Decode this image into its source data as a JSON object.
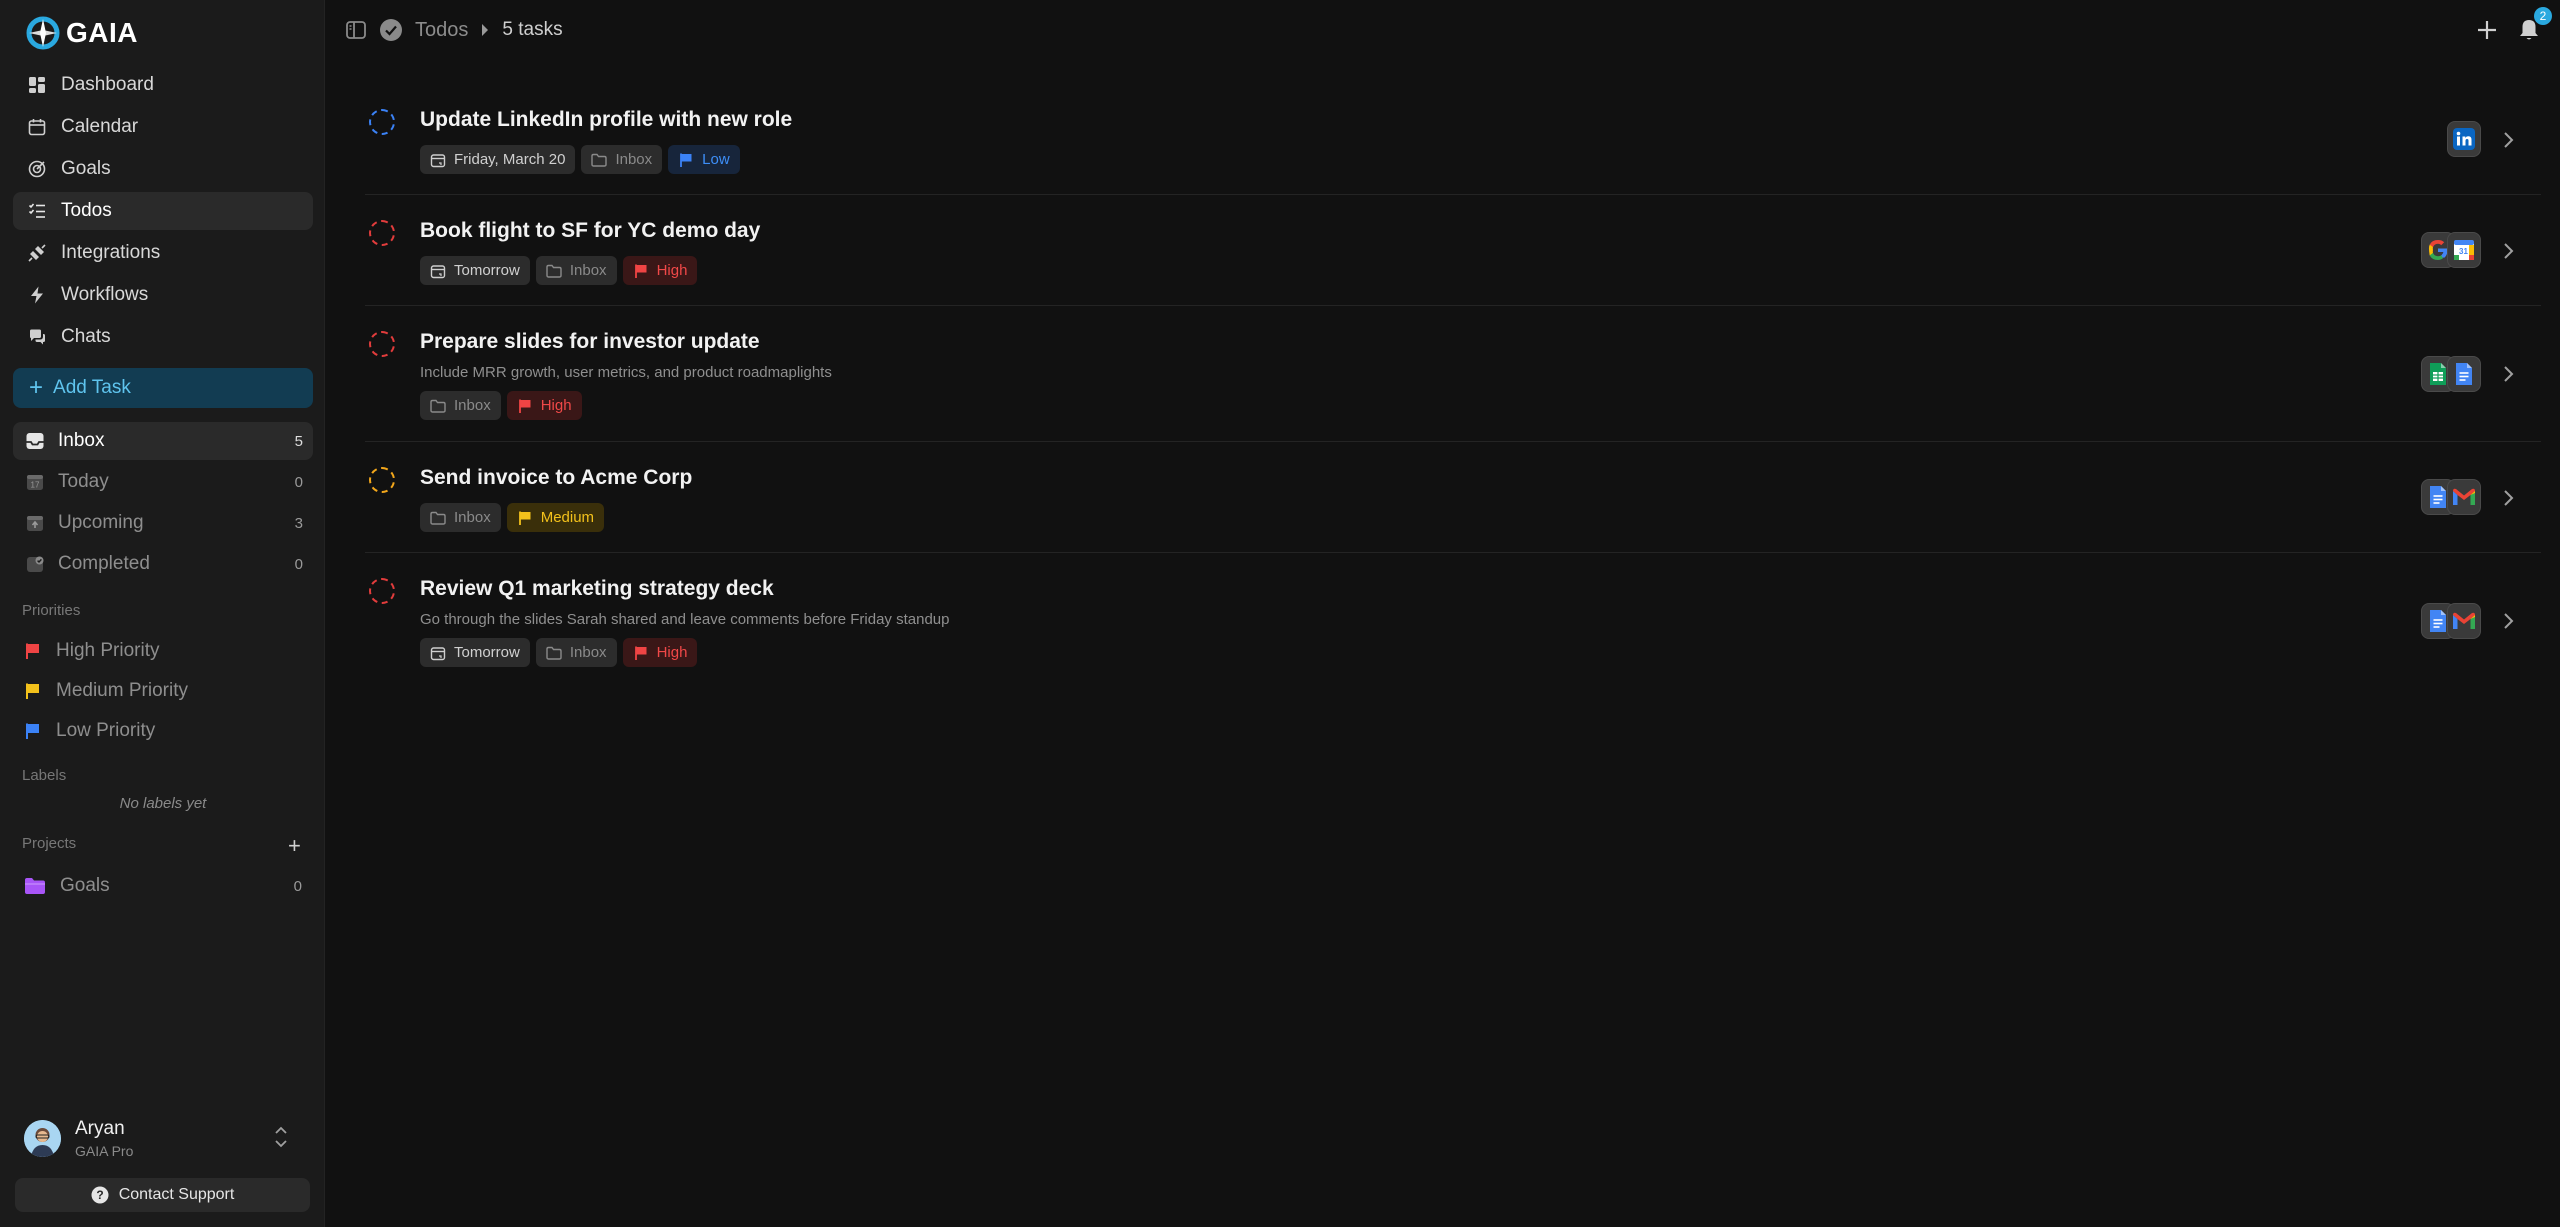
{
  "app": {
    "logo_text": "GAIA"
  },
  "sidebar": {
    "nav": [
      {
        "label": "Dashboard",
        "icon": "dashboard-icon"
      },
      {
        "label": "Calendar",
        "icon": "calendar-icon"
      },
      {
        "label": "Goals",
        "icon": "goals-icon"
      },
      {
        "label": "Todos",
        "icon": "todos-icon",
        "active": true
      },
      {
        "label": "Integrations",
        "icon": "integrations-icon"
      },
      {
        "label": "Workflows",
        "icon": "lightning-icon"
      },
      {
        "label": "Chats",
        "icon": "chats-icon"
      }
    ],
    "add_task_label": "Add Task",
    "filters": [
      {
        "label": "Inbox",
        "count": "5",
        "active": true
      },
      {
        "label": "Today",
        "count": "0"
      },
      {
        "label": "Upcoming",
        "count": "3"
      },
      {
        "label": "Completed",
        "count": "0"
      }
    ],
    "priorities_heading": "Priorities",
    "priorities": [
      {
        "label": "High Priority",
        "color": "#ef4444"
      },
      {
        "label": "Medium Priority",
        "color": "#f3c11b"
      },
      {
        "label": "Low Priority",
        "color": "#3b82f6"
      }
    ],
    "labels_heading": "Labels",
    "labels_empty": "No labels yet",
    "projects_heading": "Projects",
    "projects": [
      {
        "label": "Goals",
        "count": "0",
        "color": "#a855f7"
      }
    ],
    "user": {
      "name": "Aryan",
      "plan": "GAIA Pro"
    },
    "support_label": "Contact Support"
  },
  "topbar": {
    "title": "Todos",
    "task_count": "5 tasks",
    "notification_count": "2"
  },
  "colors": {
    "accent": "#2aa9e0",
    "high": "#ef4444",
    "medium": "#f3c11b",
    "low": "#3b82f6"
  },
  "tasks": [
    {
      "title": "Update LinkedIn profile with new role",
      "description": "",
      "date": "Friday, March 20",
      "project": "Inbox",
      "priority": "Low",
      "apps": [
        "linkedin-icon"
      ]
    },
    {
      "title": "Book flight to SF for YC demo day",
      "description": "",
      "date": "Tomorrow",
      "project": "Inbox",
      "priority": "High",
      "apps": [
        "google-icon",
        "google-calendar-icon"
      ]
    },
    {
      "title": "Prepare slides for investor update",
      "description": "Include MRR growth, user metrics, and product roadmaplights",
      "date": "",
      "project": "Inbox",
      "priority": "High",
      "apps": [
        "google-sheets-icon",
        "google-docs-icon"
      ]
    },
    {
      "title": "Send invoice to Acme Corp",
      "description": "",
      "date": "",
      "project": "Inbox",
      "priority": "Medium",
      "apps": [
        "google-docs-icon",
        "gmail-icon"
      ]
    },
    {
      "title": "Review Q1 marketing strategy deck",
      "description": "Go through the slides Sarah shared and leave comments before Friday standup",
      "date": "Tomorrow",
      "project": "Inbox",
      "priority": "High",
      "apps": [
        "google-docs-icon",
        "gmail-icon"
      ]
    }
  ]
}
